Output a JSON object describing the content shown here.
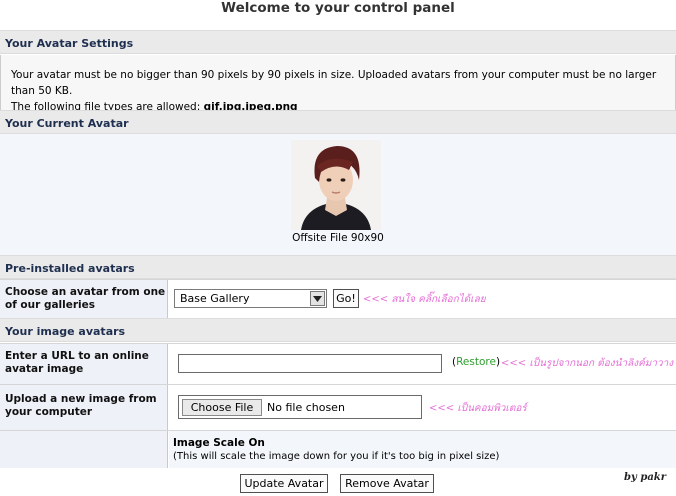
{
  "page": {
    "title": "Welcome to your control panel"
  },
  "avatar_settings": {
    "header": "Your Avatar Settings",
    "line1": "Your avatar must be no bigger than 90 pixels by 90 pixels in size. Uploaded avatars from your computer must be no larger than 50 KB.",
    "line2_prefix": "The following file types are allowed:",
    "file_types": "gif,jpg,jpeg,png"
  },
  "current_avatar": {
    "header": "Your Current Avatar",
    "caption": "Offsite File 90x90"
  },
  "preinstalled": {
    "header": "Pre-installed avatars",
    "label": "Choose an avatar from one of our galleries",
    "selected_gallery": "Base Gallery",
    "go_label": "Go!",
    "note": "<<< สนใจ คลิ๊กเลือกได้เลย"
  },
  "image_avatars": {
    "header": "Your image avatars",
    "url_label": "Enter a URL to an online avatar image",
    "url_value": "",
    "restore_open": "(",
    "restore_label": "Restore",
    "restore_close": ")",
    "url_note": "<<< เป็นรูปจากนอก ต้องนำลิงค์มาวาง",
    "upload_label": "Upload a new image from your computer",
    "choose_file_label": "Choose File",
    "no_file_text": "No file chosen",
    "upload_note": "<<< เป็นคอมพิวเตอร์",
    "scale_title": "Image Scale On",
    "scale_desc": "(This will scale the image down for you if it's too big in pixel size)"
  },
  "footer": {
    "update_label": "Update Avatar",
    "remove_label": "Remove Avatar",
    "signature": "by pakr"
  },
  "colors": {
    "section_header_bg": "#eaeaea",
    "label_cell_bg": "#eef2f8",
    "note_pink": "#e46fd6",
    "restore_green": "#2f9e2f"
  }
}
